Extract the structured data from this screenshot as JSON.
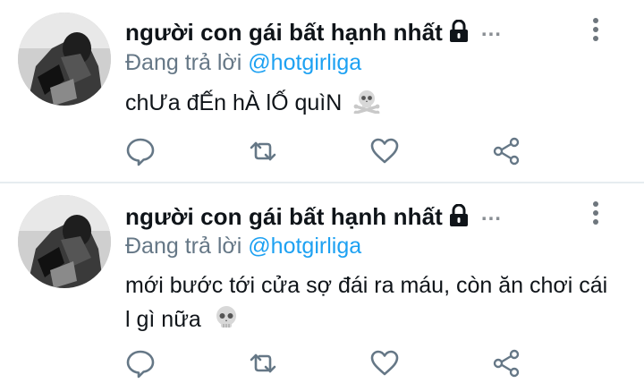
{
  "tweets": [
    {
      "author": "người con gái bất hạnh nhất",
      "more": "...",
      "reply_prefix": "Đang trả lời",
      "reply_to": "@hotgirliga",
      "text": "chƯa đẾn hÀ lỐ quìN",
      "emoji": "skull-and-crossbones-icon"
    },
    {
      "author": "người con gái bất hạnh nhất",
      "more": "...",
      "reply_prefix": "Đang trả lời",
      "reply_to": "@hotgirliga",
      "text": "mới bước tới cửa sợ đái ra máu, còn ăn chơi cái l gì nữa",
      "emoji": "skull-icon"
    }
  ],
  "colors": {
    "text": "#0f1419",
    "secondary": "#657786",
    "link": "#1da1f2",
    "icon": "#657786",
    "divider": "#e6ecf0"
  }
}
